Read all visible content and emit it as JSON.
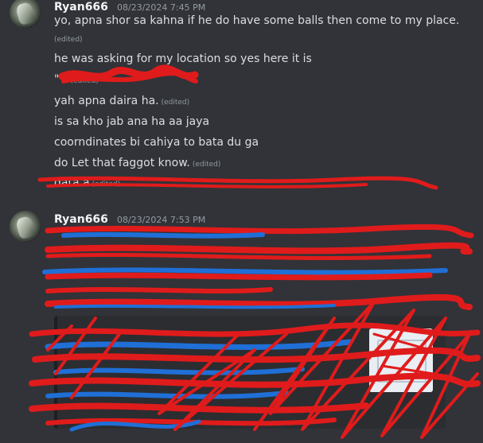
{
  "messages": [
    {
      "author": "Ryan666",
      "timestamp": "08/23/2024 7:45 PM",
      "lines": [
        {
          "text": "yo, apna shor sa kahna if he do have some balls then come to my place.",
          "edited": ""
        },
        {
          "text": "",
          "edited": "(edited)"
        },
        {
          "text": "he was asking for my location so yes here it is",
          "edited": ""
        },
        {
          "text": "\"                                  \"",
          "edited": "(edited)"
        },
        {
          "text": "yah apna daira ha.",
          "edited": "(edited)"
        },
        {
          "text": "is sa kho jab ana ha aa jaya",
          "edited": ""
        },
        {
          "text": "coorndinates bi cahiya to bata du ga",
          "edited": ""
        },
        {
          "text": "do Let that faggot know.",
          "edited": "(edited)"
        },
        {
          "text": "                                                   data a",
          "edited": "(edited)"
        }
      ]
    },
    {
      "author": "Ryan666",
      "timestamp": "08/23/2024 7:53 PM"
    }
  ],
  "colors": {
    "background": "#313338",
    "embed_background": "#2b2d31",
    "redaction_red": "#e01b1b",
    "redaction_blue": "#1f6fd6"
  }
}
